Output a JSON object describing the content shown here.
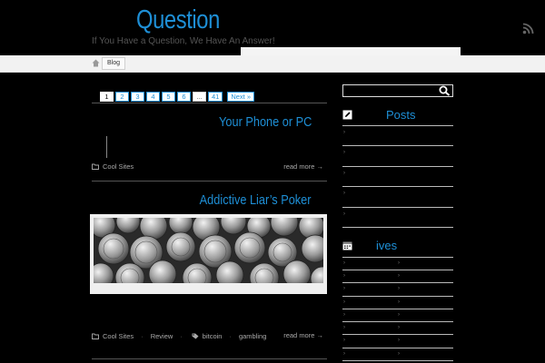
{
  "site": {
    "title": "Question",
    "tagline": "If You Have a Question, We Have An Answer!"
  },
  "nav": {
    "blog_label": "Blog"
  },
  "pagination": {
    "pages": [
      "1",
      "2",
      "3",
      "4",
      "5",
      "6",
      "...",
      "41"
    ],
    "next_label": "Next »"
  },
  "posts": [
    {
      "title": "Your Phone or PC",
      "category": "Cool Sites",
      "read_more": "read more →"
    },
    {
      "title": "Addictive Liar’s Poker",
      "categories": [
        "Cool Sites",
        "Review"
      ],
      "tags": [
        "bitcoin",
        "gambling"
      ],
      "read_more": "read more →"
    }
  ],
  "sidebar": {
    "posts_widget_title": "Posts",
    "archives_widget_title": "ives"
  },
  "colors": {
    "accent": "#1e8fd6",
    "background": "#000000",
    "navbar": "#f2f2f2"
  },
  "icons": [
    "rss-icon",
    "home-icon",
    "folder-icon",
    "tag-icon",
    "search-icon",
    "edit-icon",
    "calendar-icon"
  ]
}
